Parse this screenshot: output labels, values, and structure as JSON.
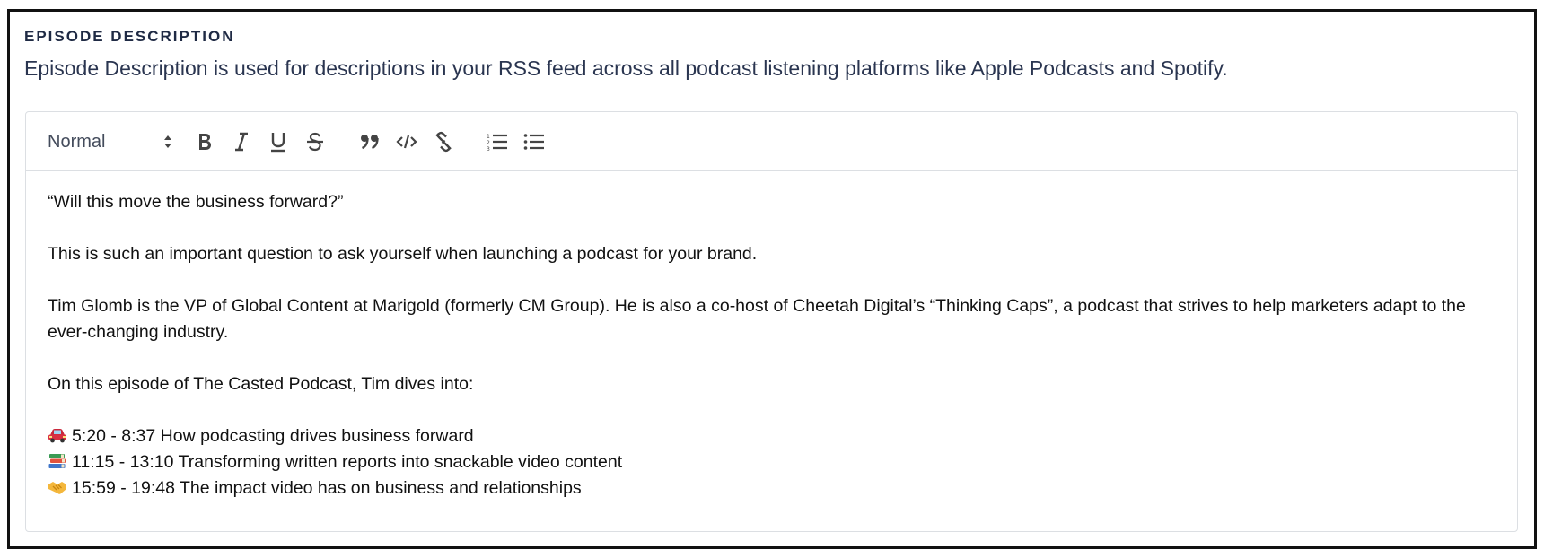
{
  "section": {
    "title": "EPISODE DESCRIPTION",
    "help_text": "Episode Description is used for descriptions in your RSS feed across all podcast listening platforms like Apple Podcasts and Spotify."
  },
  "toolbar": {
    "format_select_value": "Normal",
    "buttons": [
      {
        "name": "bold",
        "icon": "bold-icon"
      },
      {
        "name": "italic",
        "icon": "italic-icon"
      },
      {
        "name": "underline",
        "icon": "underline-icon"
      },
      {
        "name": "strikethrough",
        "icon": "strikethrough-icon"
      },
      {
        "name": "blockquote",
        "icon": "quote-icon"
      },
      {
        "name": "code",
        "icon": "code-icon"
      },
      {
        "name": "link",
        "icon": "link-icon"
      },
      {
        "name": "ordered-list",
        "icon": "ordered-list-icon"
      },
      {
        "name": "bullet-list",
        "icon": "bullet-list-icon"
      }
    ]
  },
  "content": {
    "paragraph_1": "“Will this move the business forward?”",
    "paragraph_2": "This is such an important question to ask yourself when launching a podcast for your brand.",
    "paragraph_3": "Tim Glomb is the VP of Global Content at Marigold (formerly CM Group). He is also a co-host of Cheetah Digital’s “Thinking Caps”, a podcast that strives to help marketers adapt to the ever-changing industry.",
    "paragraph_4": "On this episode of The Casted Podcast, Tim dives into:",
    "timestamps": [
      {
        "emoji": "car-emoji",
        "text": "5:20 - 8:37 How podcasting drives business forward"
      },
      {
        "emoji": "books-emoji",
        "text": "11:15 - 13:10 Transforming written reports into snackable video content"
      },
      {
        "emoji": "handshake-emoji",
        "text": "15:59 - 19:48 The impact video has on business and relationships"
      }
    ]
  }
}
